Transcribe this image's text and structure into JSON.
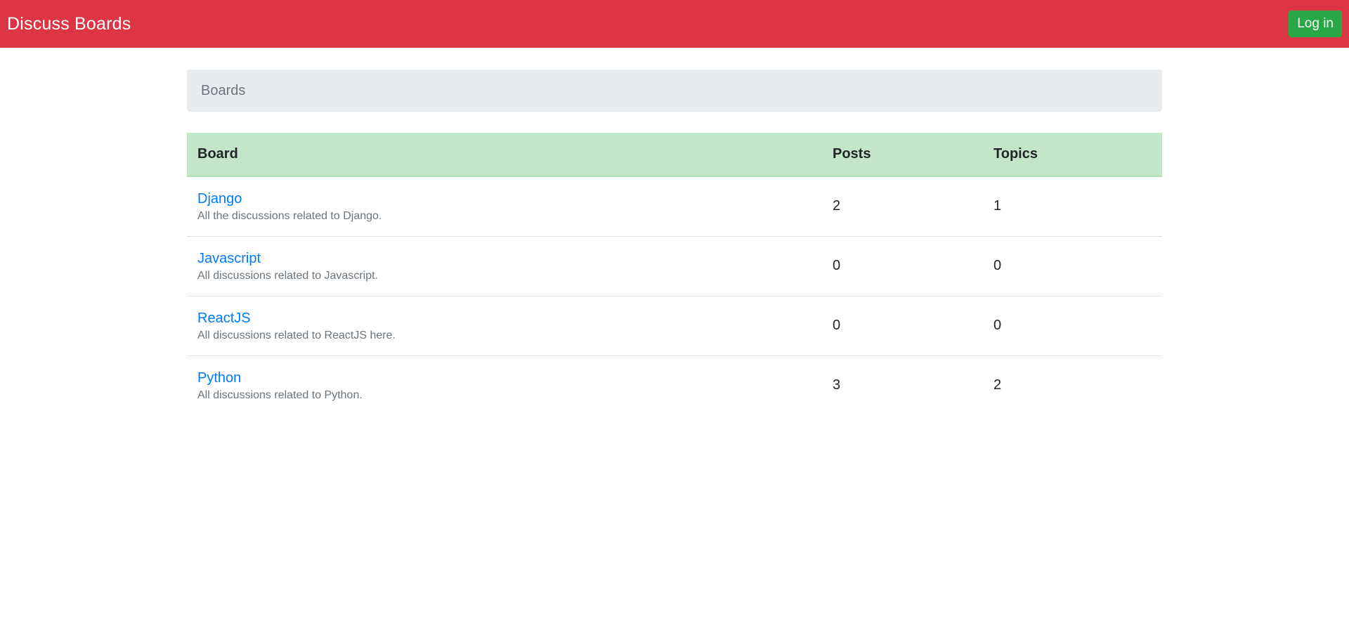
{
  "navbar": {
    "brand": "Discuss Boards",
    "login_label": "Log in",
    "background_color": "#dc3545",
    "login_color": "#28a745"
  },
  "breadcrumb": {
    "items": [
      "Boards"
    ]
  },
  "table": {
    "header_color": "#c3e6cb",
    "columns": [
      "Board",
      "Posts",
      "Topics"
    ],
    "rows": [
      {
        "name": "Django",
        "description": "All the discussions related to Django.",
        "posts": "2",
        "topics": "1"
      },
      {
        "name": "Javascript",
        "description": "All discussions related to Javascript.",
        "posts": "0",
        "topics": "0"
      },
      {
        "name": "ReactJS",
        "description": "All discussions related to ReactJS here.",
        "posts": "0",
        "topics": "0"
      },
      {
        "name": "Python",
        "description": "All discussions related to Python.",
        "posts": "3",
        "topics": "2"
      }
    ]
  }
}
